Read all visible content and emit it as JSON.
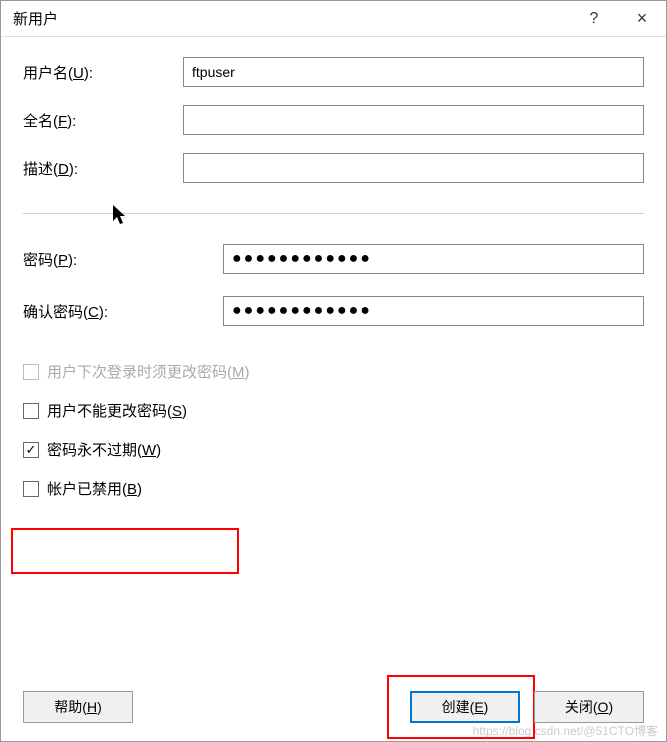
{
  "title": "新用户",
  "titlebar": {
    "help_char": "?",
    "close_char": "×"
  },
  "fields": {
    "username": {
      "label": "用户名(U):",
      "label_prefix": "用户名(",
      "label_key": "U",
      "label_suffix": "):",
      "value": "ftpuser"
    },
    "fullname": {
      "label_prefix": "全名(",
      "label_key": "F",
      "label_suffix": "):",
      "value": ""
    },
    "description": {
      "label_prefix": "描述(",
      "label_key": "D",
      "label_suffix": "):",
      "value": ""
    },
    "password": {
      "label_prefix": "密码(",
      "label_key": "P",
      "label_suffix": "):",
      "value": "●●●●●●●●●●●●"
    },
    "confirm_password": {
      "label_prefix": "确认密码(",
      "label_key": "C",
      "label_suffix": "):",
      "value": "●●●●●●●●●●●●"
    }
  },
  "checkboxes": {
    "must_change": {
      "label_prefix": "用户下次登录时须更改密码(",
      "label_key": "M",
      "label_suffix": ")",
      "checked": false,
      "disabled": true
    },
    "cannot_change": {
      "label_prefix": "用户不能更改密码(",
      "label_key": "S",
      "label_suffix": ")",
      "checked": false,
      "disabled": false
    },
    "never_expires": {
      "label_prefix": "密码永不过期(",
      "label_key": "W",
      "label_suffix": ")",
      "checked": true,
      "disabled": false
    },
    "disabled_account": {
      "label_prefix": "帐户已禁用(",
      "label_key": "B",
      "label_suffix": ")",
      "checked": false,
      "disabled": false
    }
  },
  "buttons": {
    "help": {
      "label_prefix": "帮助(",
      "label_key": "H",
      "label_suffix": ")"
    },
    "create": {
      "label_prefix": "创建(",
      "label_key": "E",
      "label_suffix": ")"
    },
    "close": {
      "label_prefix": "关闭(",
      "label_key": "O",
      "label_suffix": ")"
    }
  },
  "watermark": "https://blog.csdn.net/@51CTO博客"
}
